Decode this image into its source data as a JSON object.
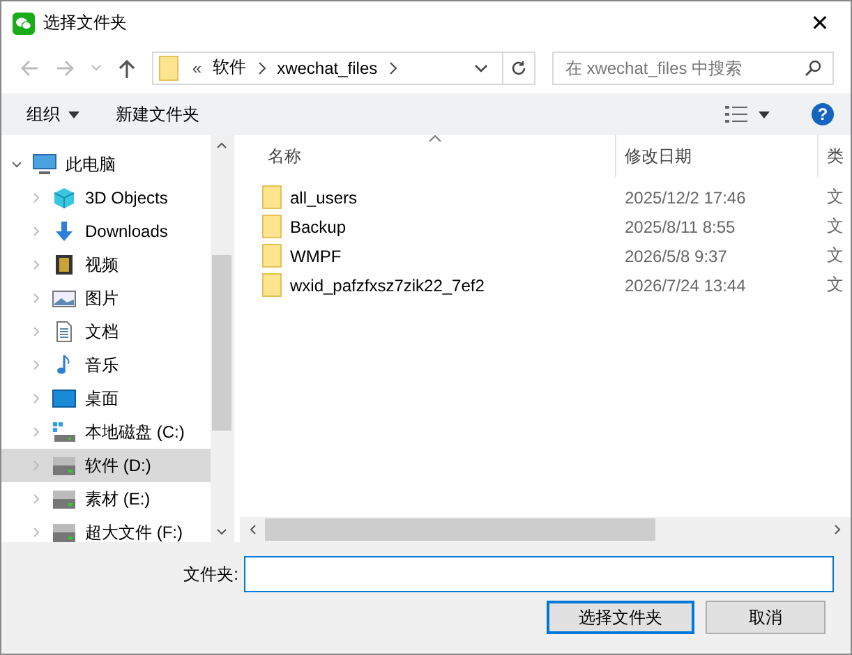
{
  "window": {
    "title": "选择文件夹",
    "close": "✕"
  },
  "address": {
    "overflow": "«",
    "crumbs": [
      "软件",
      "xwechat_files"
    ]
  },
  "search": {
    "placeholder": "在 xwechat_files 中搜索"
  },
  "toolbar": {
    "organize": "组织",
    "new_folder": "新建文件夹",
    "help": "?"
  },
  "tree": [
    {
      "label": "此电脑",
      "kind": "computer",
      "expanded": true,
      "selected": false,
      "children": [
        {
          "label": "3D Objects",
          "kind": "objects3d",
          "expanded": false,
          "selected": false
        },
        {
          "label": "Downloads",
          "kind": "downloads",
          "expanded": false,
          "selected": false
        },
        {
          "label": "视频",
          "kind": "videos",
          "expanded": false,
          "selected": false
        },
        {
          "label": "图片",
          "kind": "pictures",
          "expanded": false,
          "selected": false
        },
        {
          "label": "文档",
          "kind": "documents",
          "expanded": false,
          "selected": false
        },
        {
          "label": "音乐",
          "kind": "music",
          "expanded": false,
          "selected": false
        },
        {
          "label": "桌面",
          "kind": "desktop",
          "expanded": false,
          "selected": false
        },
        {
          "label": "本地磁盘 (C:)",
          "kind": "system-drive",
          "expanded": false,
          "selected": false
        },
        {
          "label": "软件 (D:)",
          "kind": "drive",
          "expanded": false,
          "selected": true
        },
        {
          "label": "素材 (E:)",
          "kind": "drive",
          "expanded": false,
          "selected": false
        },
        {
          "label": "超大文件 (F:)",
          "kind": "drive",
          "expanded": false,
          "selected": false
        }
      ]
    }
  ],
  "table": {
    "columns": [
      "名称",
      "修改日期",
      "类"
    ],
    "rows": [
      {
        "name": "all_users",
        "modified": "2025/12/2 17:46",
        "type": "文"
      },
      {
        "name": "Backup",
        "modified": "2025/8/11 8:55",
        "type": "文"
      },
      {
        "name": "WMPF",
        "modified": "2026/5/8 9:37",
        "type": "文"
      },
      {
        "name": "wxid_pafzfxsz7zik22_7ef2",
        "modified": "2026/7/24 13:44",
        "type": "文"
      }
    ]
  },
  "folder_field": {
    "label": "文件夹:"
  },
  "buttons": [
    "选择文件夹",
    "取消"
  ]
}
